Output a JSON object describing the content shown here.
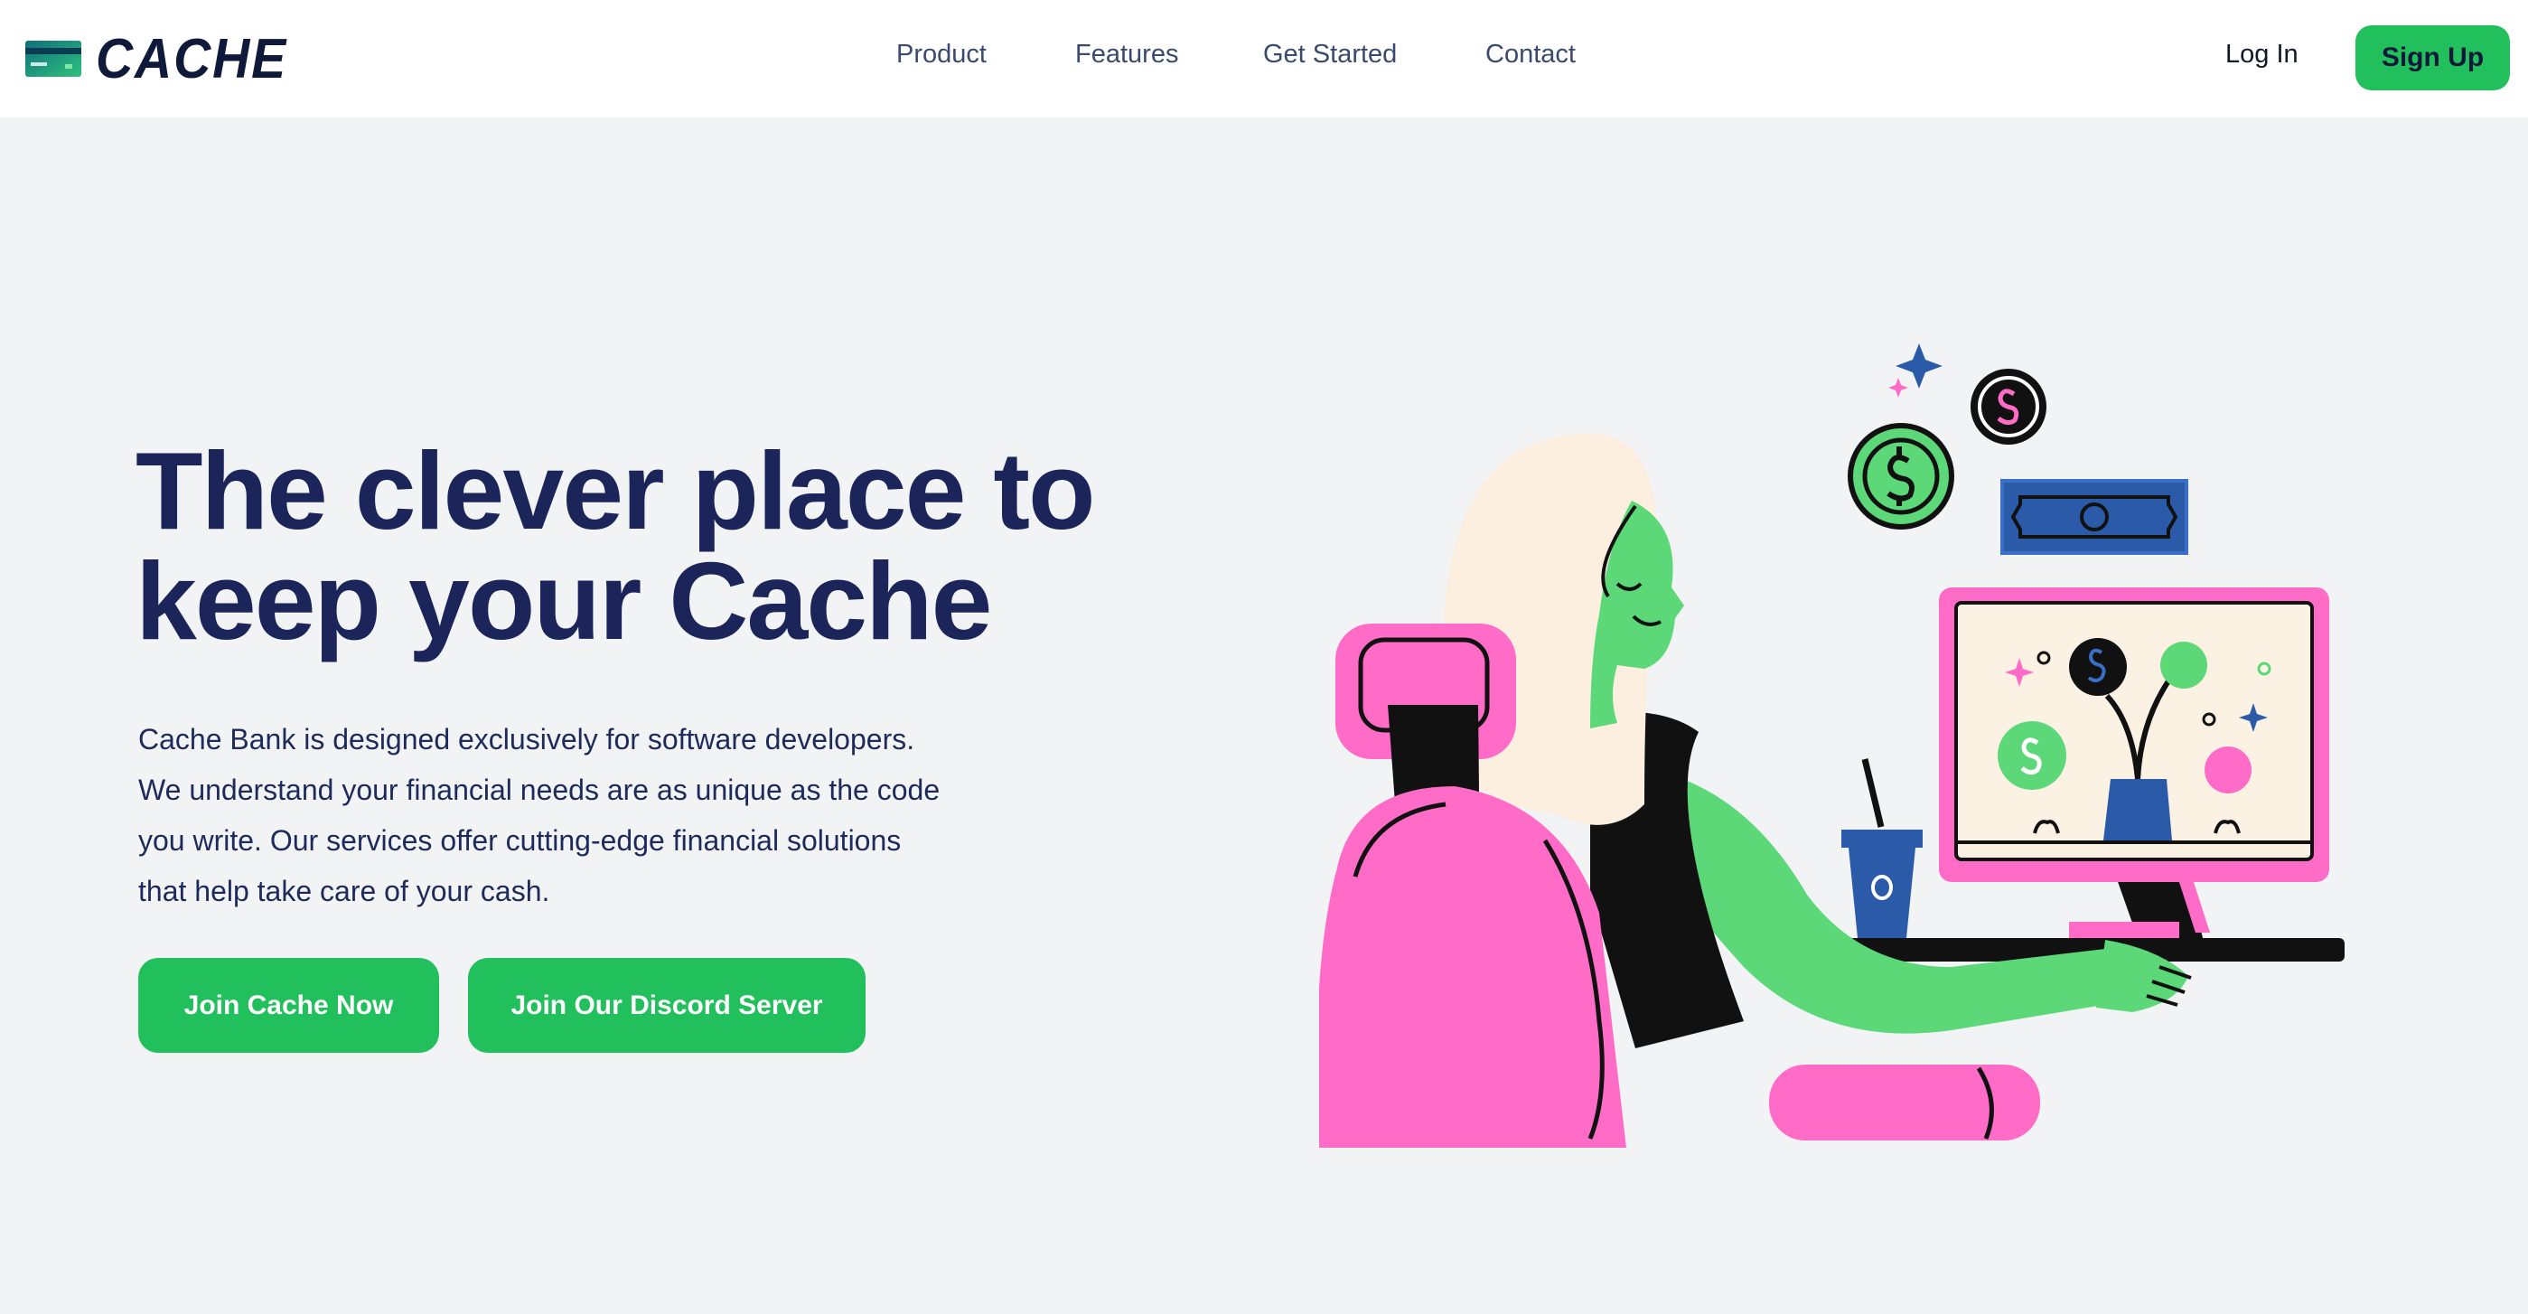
{
  "brand": {
    "name": "CACHE",
    "logo_icon": "credit-card-icon",
    "logo_colors": [
      "#0f6f7a",
      "#2ec27e"
    ]
  },
  "nav": {
    "items": [
      {
        "label": "Product"
      },
      {
        "label": "Features"
      },
      {
        "label": "Get Started"
      },
      {
        "label": "Contact"
      }
    ],
    "login_label": "Log In",
    "signup_label": "Sign Up"
  },
  "hero": {
    "title_line1": "The clever place to",
    "title_line2": "keep your Cache",
    "description": "Cache Bank is designed exclusively for software developers. We understand your financial needs are as unique as the code you write. Our services offer cutting-edge financial solutions that help take care of your cash.",
    "cta_primary": "Join Cache Now",
    "cta_secondary": "Join Our Discord Server"
  },
  "colors": {
    "accent": "#22c05c",
    "navy": "#1b2559",
    "pink": "#ff6cc8",
    "green": "#5cd878",
    "blue": "#2b5ba8",
    "background": "#f2f3f5"
  }
}
